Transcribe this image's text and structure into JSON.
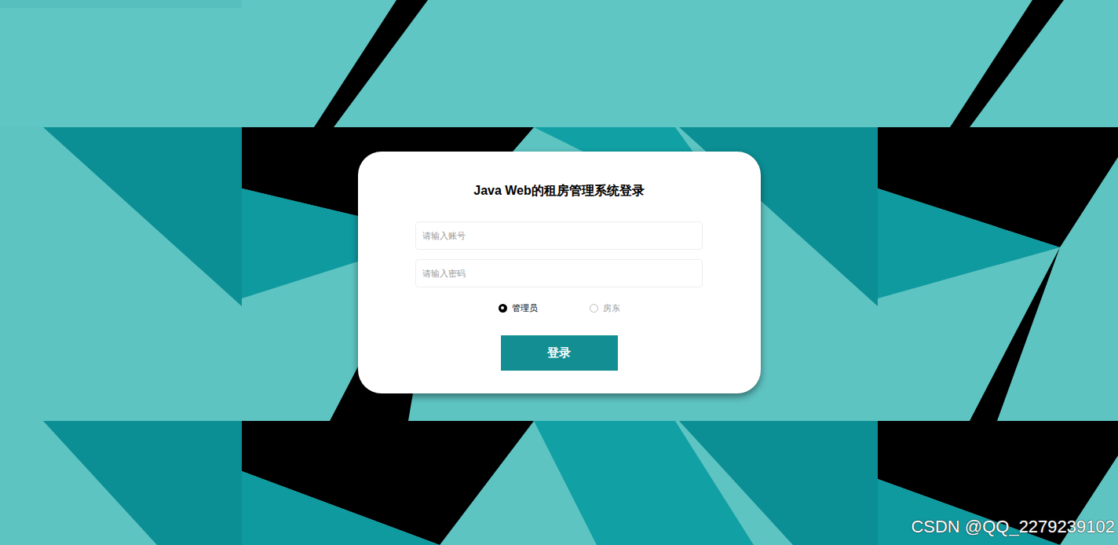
{
  "page": {
    "title": "Java Web的租房管理系统登录"
  },
  "fields": [
    {
      "placeholder": "请输入账号",
      "kind": "text"
    },
    {
      "placeholder": "请输入密码",
      "kind": "password"
    }
  ],
  "roles": [
    {
      "label": "管理员",
      "selected": true
    },
    {
      "label": "房东",
      "selected": false
    }
  ],
  "button": "登录",
  "watermark": "CSDN @QQ_2279239102"
}
